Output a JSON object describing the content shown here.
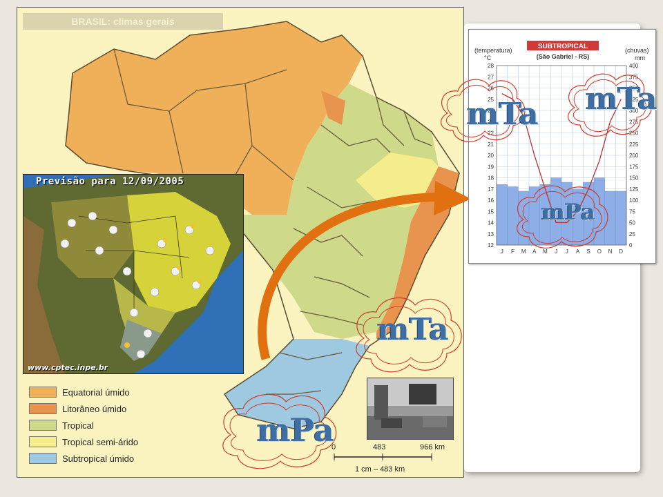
{
  "map": {
    "header_text": "BRASIL: climas gerais"
  },
  "forecast": {
    "title": "Previsão para 12/09/2005",
    "url": "www.cptec.inpe.br"
  },
  "legend": {
    "items": [
      {
        "label": "Equatorial úmido",
        "color": "#f0b05a"
      },
      {
        "label": "Litorâneo úmido",
        "color": "#e8944e"
      },
      {
        "label": "Tropical",
        "color": "#cfd98a"
      },
      {
        "label": "Tropical semi-árido",
        "color": "#f5ec8c"
      },
      {
        "label": "Subtropical úmido",
        "color": "#9ec9e0"
      }
    ]
  },
  "scale": {
    "zero": "0",
    "mid": "483",
    "end": "966 km",
    "caption": "1 cm – 483 km"
  },
  "climograph": {
    "title": "SUBTROPICAL",
    "subtitle": "(São Gabriel - RS)",
    "left_axis_label": "(temperatura)",
    "left_unit": "°C",
    "right_axis_label": "(chuvas)",
    "right_unit": "mm",
    "months": [
      "J",
      "F",
      "M",
      "A",
      "M",
      "J",
      "J",
      "A",
      "S",
      "O",
      "N",
      "D"
    ],
    "temp_ticks": [
      "28",
      "27",
      "26",
      "25",
      "24",
      "23",
      "22",
      "21",
      "20",
      "19",
      "18",
      "17",
      "16",
      "15",
      "14",
      "13",
      "12"
    ],
    "rain_ticks": [
      "400",
      "375",
      "350",
      "325",
      "300",
      "275",
      "250",
      "225",
      "200",
      "175",
      "150",
      "125",
      "100",
      "75",
      "50",
      "25",
      "0"
    ],
    "rain_mm": [
      135,
      130,
      120,
      130,
      135,
      150,
      140,
      125,
      140,
      150,
      120,
      120
    ],
    "temp_c": [
      25.5,
      25,
      23.5,
      20,
      17,
      14,
      14,
      15,
      17,
      19.5,
      23,
      25
    ]
  },
  "air_masses": {
    "mta_left": "mTa",
    "mta_right": "mTa",
    "mpa_chart": "mPa",
    "mta_map": "mTa",
    "mpa_map": "mPa"
  },
  "colors": {
    "mass_text": "#3e6fa2",
    "arrow": "#e07010",
    "cloud_outline": "#d03a2a"
  }
}
